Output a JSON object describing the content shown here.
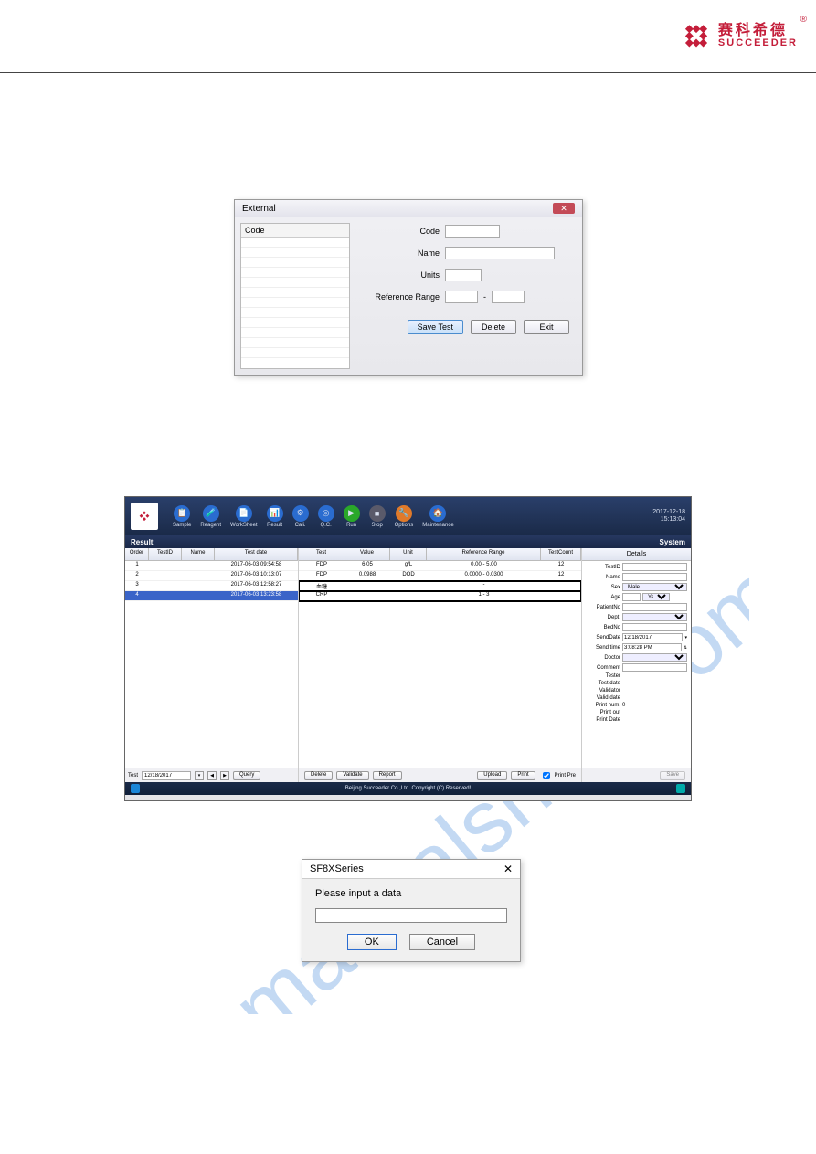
{
  "header": {
    "logo_cn": "赛科希德",
    "logo_en": "SUCCEEDER",
    "reg": "®"
  },
  "watermark_text": "manualshive.com",
  "external_dialog": {
    "title": "External",
    "code_header": "Code",
    "labels": {
      "code": "Code",
      "name": "Name",
      "units": "Units",
      "ref_range": "Reference Range",
      "dash": "-"
    },
    "buttons": {
      "save": "Save Test",
      "delete": "Delete",
      "exit": "Exit"
    }
  },
  "app": {
    "toolbar": {
      "items": [
        {
          "label": "Sample",
          "color": "#2a6cd0",
          "glyph": "📋"
        },
        {
          "label": "Reagent",
          "color": "#2a6cd0",
          "glyph": "🧪"
        },
        {
          "label": "WorkSheet",
          "color": "#2a6cd0",
          "glyph": "📄"
        },
        {
          "label": "Result",
          "color": "#2a6cd0",
          "glyph": "📊"
        },
        {
          "label": "Cali.",
          "color": "#2a6cd0",
          "glyph": "⚙"
        },
        {
          "label": "Q.C.",
          "color": "#2a6cd0",
          "glyph": "◎"
        },
        {
          "label": "Run",
          "color": "#2aa82a",
          "glyph": "▶"
        },
        {
          "label": "Stop",
          "color": "#5a5a6a",
          "glyph": "■"
        },
        {
          "label": "Options",
          "color": "#e07a2a",
          "glyph": "🔧"
        },
        {
          "label": "Maintenance",
          "color": "#2a6cd0",
          "glyph": "🏠"
        }
      ],
      "date": "2017-12-18",
      "time": "15:13:04"
    },
    "subheader": {
      "left": "Result",
      "right": "System"
    },
    "samples": {
      "headers": [
        "Order",
        "TestID",
        "Name",
        "Test date"
      ],
      "rows": [
        {
          "order": "1",
          "testid": "",
          "name": "",
          "date": "2017-06-03 09:54:58",
          "selected": false
        },
        {
          "order": "2",
          "testid": "",
          "name": "",
          "date": "2017-06-03 10:13:07",
          "selected": false
        },
        {
          "order": "3",
          "testid": "",
          "name": "",
          "date": "2017-06-03 12:58:27",
          "selected": false
        },
        {
          "order": "4",
          "testid": "",
          "name": "",
          "date": "2017-06-03 13:23:58",
          "selected": true
        }
      ],
      "footer": {
        "label": "Test",
        "date": "12/18/2017",
        "query": "Query"
      }
    },
    "tests": {
      "headers": [
        "Test",
        "Value",
        "Unit",
        "Reference Range",
        "TestCount"
      ],
      "rows": [
        {
          "test": "FDP",
          "value": "6.05",
          "unit": "g/L",
          "range": "0.00 - 5.00",
          "count": "12",
          "hl": false
        },
        {
          "test": "FDP",
          "value": "0.0988",
          "unit": "DOD",
          "range": "0.0000 - 0.0300",
          "count": "12",
          "hl": false,
          "value_color": "#2040d0"
        },
        {
          "test": "血糖",
          "value": "",
          "unit": "",
          "range": "-",
          "count": "",
          "hl": true
        },
        {
          "test": "CRP",
          "value": "",
          "unit": "",
          "range": "1 - 3",
          "count": "",
          "hl": true
        }
      ],
      "footer": {
        "delete": "Delete",
        "validate": "Validate",
        "report": "Report",
        "upload": "Upload",
        "print": "Print",
        "printpre": "Print Pre"
      }
    },
    "details": {
      "header": "Details",
      "fields": {
        "testid": "TestID",
        "name": "Name",
        "sex": "Sex",
        "sex_value": "Male",
        "age": "Age",
        "age_unit": "Year",
        "patientno": "PatientNo",
        "dept": "Dept.",
        "bedno": "BedNo",
        "senddate": "SendDate",
        "senddate_value": "12/18/2017",
        "sendtime": "Send time",
        "sendtime_value": "3:08:28 PM",
        "doctor": "Doctor",
        "comment": "Comment",
        "tester": "Tester",
        "testdate": "Test date",
        "validator": "Validator",
        "validdate": "Valid date",
        "printnum": "Print num.",
        "printnum_value": "0",
        "printout": "Print out",
        "printdate": "Print Date"
      },
      "save": "Save"
    },
    "status": "Beijing Succeeder Co.,Ltd. Copyright (C) Reserved!"
  },
  "input_dialog": {
    "title": "SF8XSeries",
    "message": "Please input a data",
    "ok": "OK",
    "cancel": "Cancel"
  }
}
